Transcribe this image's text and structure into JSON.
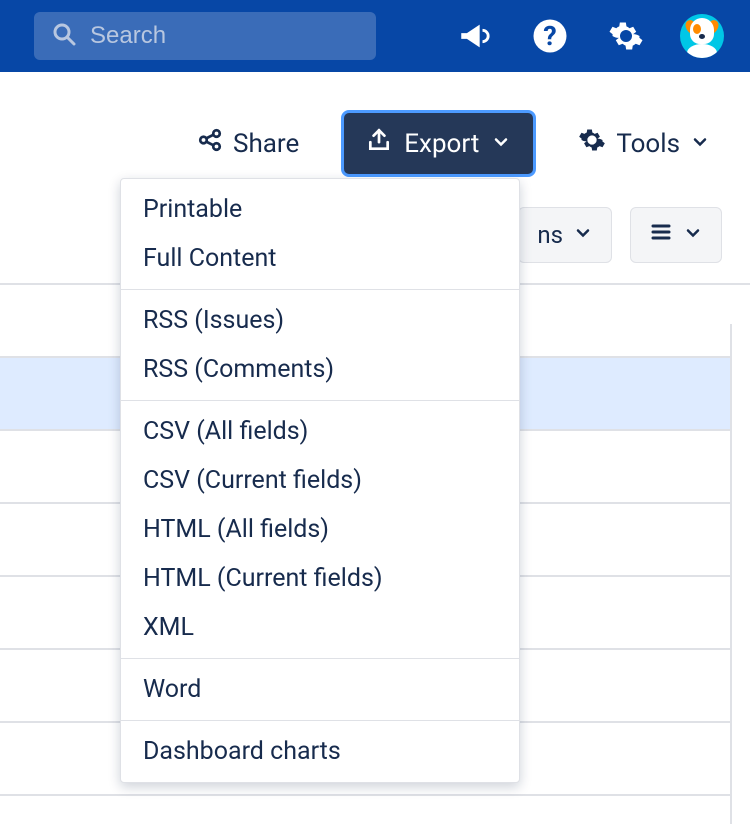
{
  "topbar": {
    "search_placeholder": "Search"
  },
  "toolbar": {
    "share_label": "Share",
    "export_label": "Export",
    "tools_label": "Tools",
    "partial_button_suffix": "ns"
  },
  "export_menu": {
    "sections": [
      {
        "items": [
          "Printable",
          "Full Content"
        ]
      },
      {
        "items": [
          "RSS (Issues)",
          "RSS (Comments)"
        ]
      },
      {
        "items": [
          "CSV (All fields)",
          "CSV (Current fields)",
          "HTML (All fields)",
          "HTML (Current fields)",
          "XML"
        ]
      },
      {
        "items": [
          "Word"
        ]
      },
      {
        "items": [
          "Dashboard charts"
        ]
      }
    ]
  },
  "colors": {
    "topbar_bg": "#0747a6",
    "export_bg": "#253858",
    "focus_ring": "#4c9aff",
    "row_highlight": "#deebff"
  }
}
